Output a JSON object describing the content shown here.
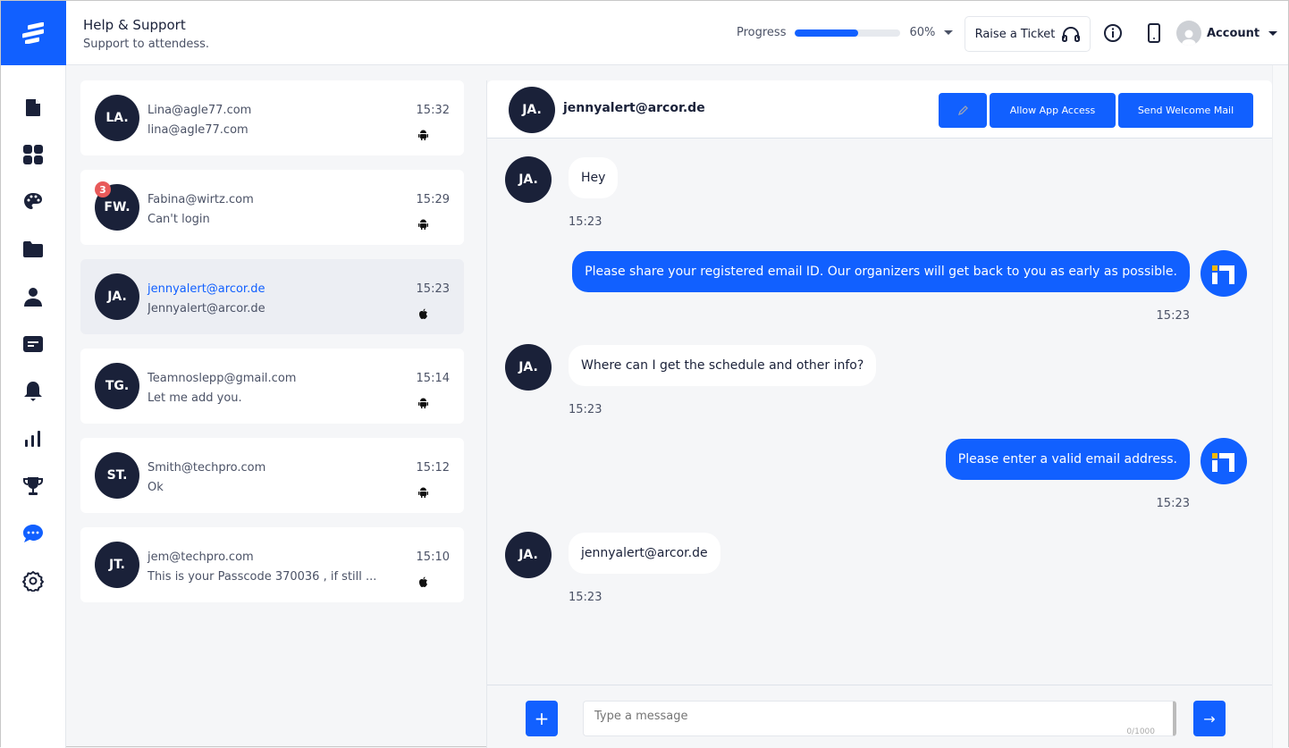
{
  "header": {
    "title": "Help & Support",
    "subtitle": "Support to attendess.",
    "progress_label": "Progress",
    "progress_percent": 60,
    "progress_text": "60%",
    "raise_ticket": "Raise a Ticket",
    "account": "Account"
  },
  "colors": {
    "accent": "#1160ff",
    "dark": "#1a2139",
    "badge": "#e85a5a"
  },
  "sidebar": {
    "items": [
      "document-icon",
      "dashboard-icon",
      "palette-icon",
      "folder-icon",
      "user-icon",
      "ticket-icon",
      "bell-icon",
      "analytics-icon",
      "trophy-icon",
      "chat-icon",
      "settings-icon"
    ],
    "active": "chat-icon"
  },
  "conversations": [
    {
      "initials": "LA.",
      "name": "Lina@agle77.com",
      "message": "lina@agle77.com",
      "time": "15:32",
      "os": "android"
    },
    {
      "initials": "FW.",
      "name": "Fabina@wirtz.com",
      "message": "Can't login",
      "time": "15:29",
      "os": "android",
      "unread": "3"
    },
    {
      "initials": "JA.",
      "name": "jennyalert@arcor.de",
      "message": "Jennyalert@arcor.de",
      "time": "15:23",
      "os": "apple",
      "active": true
    },
    {
      "initials": "TG.",
      "name": "Teamnoslepp@gmail.com",
      "message": "Let me add you.",
      "time": "15:14",
      "os": "android"
    },
    {
      "initials": "ST.",
      "name": "Smith@techpro.com",
      "message": "Ok",
      "time": "15:12",
      "os": "android"
    },
    {
      "initials": "JT.",
      "name": "jem@techpro.com",
      "message": "This is your Passcode 370036 , if still ...",
      "time": "15:10",
      "os": "apple"
    }
  ],
  "chat": {
    "initials": "JA.",
    "name": "jennyalert@arcor.de",
    "allow_access": "Allow App Access",
    "welcome_mail": "Send Welcome Mail",
    "messages": [
      {
        "from": "user",
        "text": "Hey",
        "time": "15:23"
      },
      {
        "from": "agent",
        "text": "Please share your registered email ID. Our organizers will get back to you as early as possible.",
        "time": "15:23"
      },
      {
        "from": "user",
        "text": "Where can I get the schedule and other info?",
        "time": "15:23"
      },
      {
        "from": "agent",
        "text": "Please enter a valid email address.",
        "time": "15:23"
      },
      {
        "from": "user",
        "text": "jennyalert@arcor.de",
        "time": "15:23"
      }
    ],
    "placeholder": "Type a message",
    "counter": "0/1000"
  }
}
